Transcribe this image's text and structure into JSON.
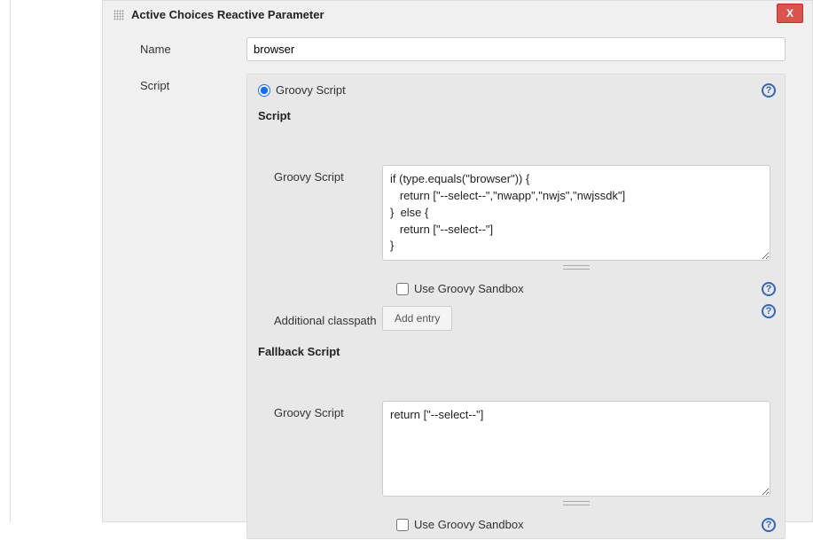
{
  "closeButton": "X",
  "header": {
    "title": "Active Choices Reactive Parameter"
  },
  "nameRow": {
    "label": "Name",
    "value": "browser"
  },
  "scriptRow": {
    "label": "Script"
  },
  "groovyRadio": {
    "label": "Groovy Script",
    "checked": true
  },
  "sections": {
    "script": "Script",
    "fallback": "Fallback Script"
  },
  "innerLabels": {
    "groovyScript": "Groovy Script",
    "additionalClasspath": "Additional classpath"
  },
  "scriptArea": {
    "value": "if (type.equals(\"browser\")) {\n   return [\"--select--\",\"nwapp\",\"nwjs\",\"nwjssdk\"]\n}  else {\n   return [\"--select--\"]\n}"
  },
  "fallbackArea": {
    "value": "return [\"--select--\"]"
  },
  "sandbox": {
    "label": "Use Groovy Sandbox",
    "checkedMain": false,
    "checkedFallback": false
  },
  "buttons": {
    "addEntry": "Add entry"
  },
  "helpGlyph": "?"
}
